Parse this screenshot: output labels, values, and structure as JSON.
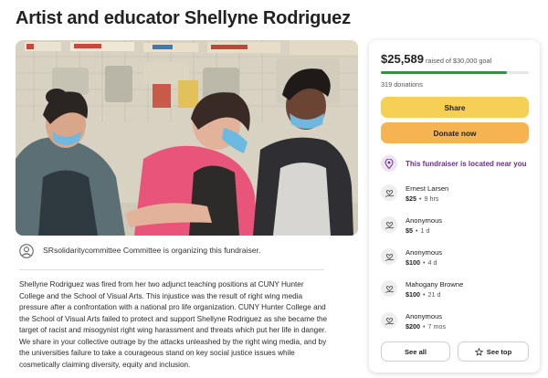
{
  "page": {
    "title": "Artist and educator Shellyne Rodriguez"
  },
  "organizer": {
    "text": "SRsolidaritycommittee Committee is organizing this fundraiser."
  },
  "story": {
    "text": "Shellyne Rodriguez was fired from her two adjunct teaching positions at CUNY Hunter College and the School of Visual Arts. This injustice was the result of right wing media pressure after a confrontation with a national pro life organization. CUNY Hunter College and the School of Visual Arts failed to protect and support Shellyne Rodriguez as she became the target of racist and misogynist right wing harassment and threats which put her life in danger. We share in your collective outrage by the attacks unleashed by the right wing media, and by the universities failure to take a courageous stand on key social justice issues while cosmetically claiming diversity, equity and inclusion."
  },
  "sidebar": {
    "raised": "$25,589",
    "goal_text": "raised of $30,000 goal",
    "progress_fraction": 0.853,
    "donations": "319 donations",
    "share_label": "Share",
    "donate_label": "Donate now",
    "near_text": "This fundraiser is located near you",
    "donors": [
      {
        "name": "Ernest Larsen",
        "amount": "$25",
        "time": "9 hrs"
      },
      {
        "name": "Anonymous",
        "amount": "$5",
        "time": "1 d"
      },
      {
        "name": "Anonymous",
        "amount": "$100",
        "time": "4 d"
      },
      {
        "name": "Mahogany Browne",
        "amount": "$100",
        "time": "21 d"
      },
      {
        "name": "Anonymous",
        "amount": "$200",
        "time": "7 mos"
      }
    ],
    "see_all_label": "See all",
    "see_top_label": "See top"
  },
  "colors": {
    "progress": "#3b8c44",
    "share": "#f6cf55",
    "donate": "#f5b451",
    "near_accent": "#6a2f86"
  },
  "icons": {
    "organizer": "person-icon",
    "near": "location-pin-icon",
    "donor": "heart-hand-icon",
    "see_top": "star-icon"
  }
}
